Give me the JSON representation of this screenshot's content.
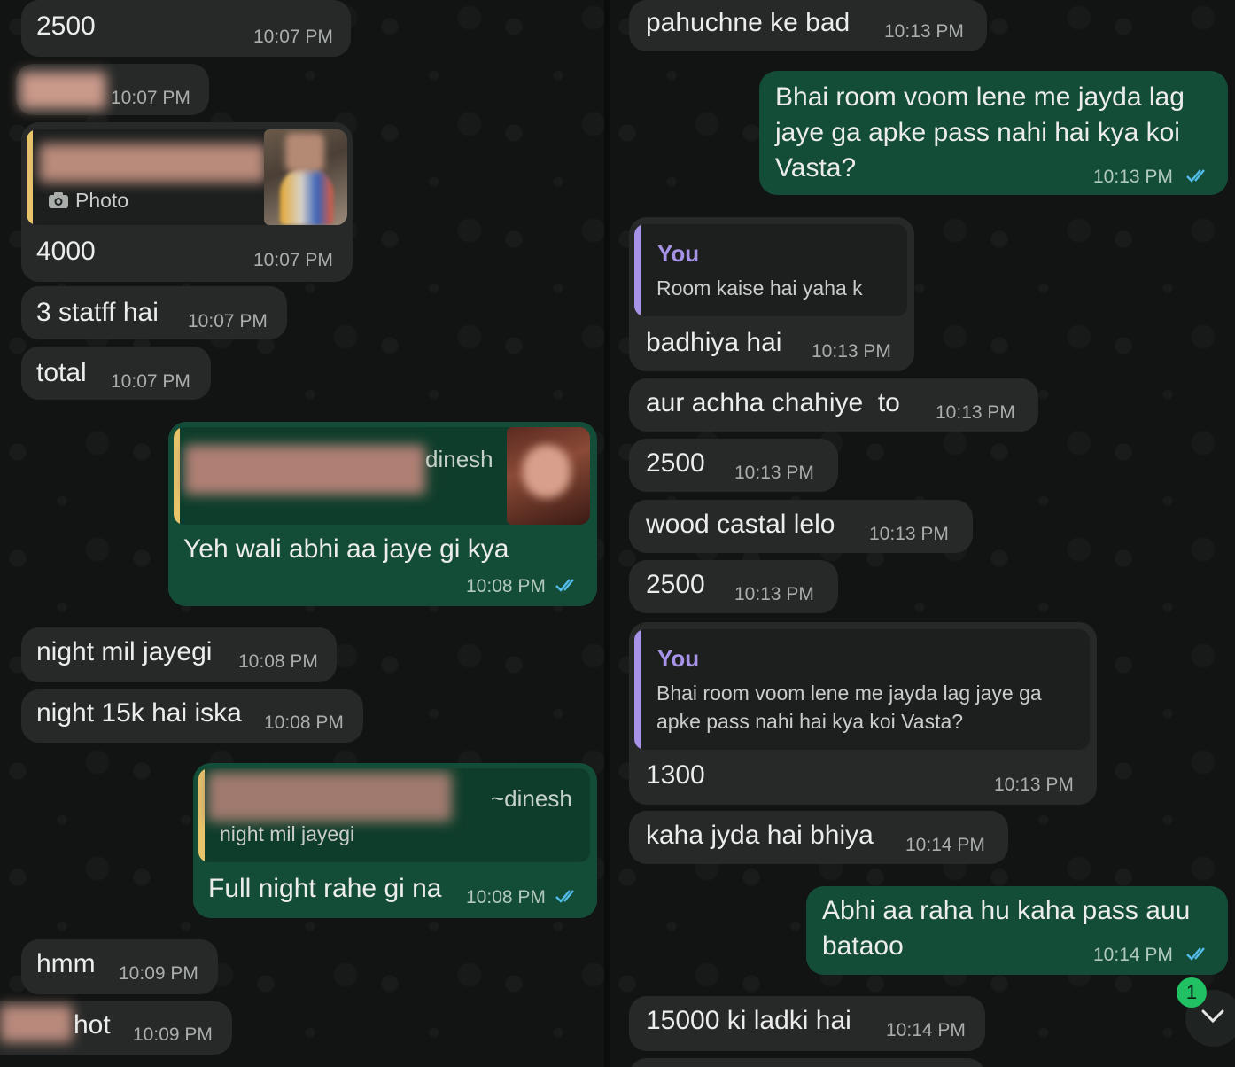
{
  "left_column": {
    "msg_2500": {
      "text": "2500",
      "time": "10:07 PM"
    },
    "msg_blurred_1": {
      "time": "10:07 PM"
    },
    "msg_photo_reply": {
      "quote_label": "Photo",
      "text": "4000",
      "time": "10:07 PM"
    },
    "msg_staff": {
      "text": "3 statff hai",
      "time": "10:07 PM"
    },
    "msg_total": {
      "text": "total",
      "time": "10:07 PM"
    },
    "msg_yeh_wali": {
      "quote_author": "dinesh",
      "text": "Yeh wali abhi aa jaye gi kya",
      "time": "10:08 PM"
    },
    "msg_night_mil": {
      "text": "night mil jayegi",
      "time": "10:08 PM"
    },
    "msg_night_15k": {
      "text": "night 15k hai iska",
      "time": "10:08 PM"
    },
    "msg_full_night": {
      "quote_author": "~dinesh",
      "quote_text": "night mil jayegi",
      "text": "Full night rahe gi na",
      "time": "10:08 PM"
    },
    "msg_hmm": {
      "text": "hmm",
      "time": "10:09 PM"
    },
    "msg_hot": {
      "text": "hot",
      "time": "10:09 PM"
    }
  },
  "right_column": {
    "msg_pahuchne": {
      "text": "pahuchne ke bad",
      "time": "10:13 PM"
    },
    "msg_bhai_room": {
      "text": "Bhai room voom lene me jayda lag jaye ga apke pass nahi hai kya koi Vasta?",
      "time": "10:13 PM"
    },
    "msg_badhiya": {
      "quote_author": "You",
      "quote_text": "Room kaise hai yaha k",
      "text": "badhiya hai",
      "time": "10:13 PM"
    },
    "msg_aur_achha": {
      "text": "aur achha chahiye  to",
      "time": "10:13 PM"
    },
    "msg_2500_a": {
      "text": "2500",
      "time": "10:13 PM"
    },
    "msg_wood": {
      "text": "wood castal lelo",
      "time": "10:13 PM"
    },
    "msg_2500_b": {
      "text": "2500",
      "time": "10:13 PM"
    },
    "msg_1300": {
      "quote_author": "You",
      "quote_text": "Bhai room voom lene me jayda lag jaye ga apke pass nahi hai kya koi Vasta?",
      "text": "1300",
      "time": "10:13 PM"
    },
    "msg_kaha_jyda": {
      "text": "kaha jyda hai bhiya",
      "time": "10:14 PM"
    },
    "msg_abhi_aa": {
      "text": "Abhi aa raha hu kaha pass auu bataoo",
      "time": "10:14 PM"
    },
    "msg_15000": {
      "text": "15000 ki ladki hai",
      "time": "10:14 PM"
    }
  },
  "unread_badge": "1",
  "icons": {
    "read_receipt": "double-check-icon",
    "camera": "camera-icon",
    "scroll_down": "chevron-down-icon"
  },
  "colors": {
    "incoming_bubble": "#262928",
    "outgoing_bubble": "#144d37",
    "quote_bar_contact": "#e8c56a",
    "quote_bar_you": "#a794e8",
    "read_tick": "#53bdeb",
    "badge": "#21c063"
  }
}
